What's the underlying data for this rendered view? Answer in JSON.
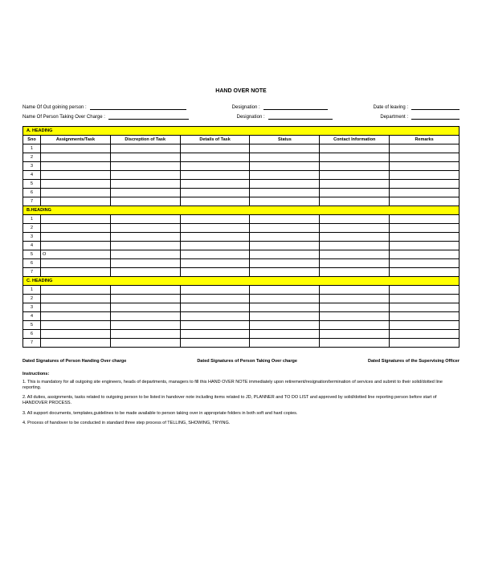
{
  "title": "HAND OVER NOTE",
  "header": {
    "row1": {
      "outgoing_label": "Name Of Out goining person :",
      "designation_label": "Designation :",
      "date_label": "Date of leaving :"
    },
    "row2": {
      "taking_over_label": "Name Of Person Taking Over Charge :",
      "designation_label": "Designation :",
      "department_label": "Department :"
    }
  },
  "columns": [
    "Sno",
    "Assignments/Task",
    "Discreption of Task",
    "Details of Task",
    "Status",
    "Contact Information",
    "Remarks"
  ],
  "sections": [
    {
      "title": "A. HEADING",
      "rows": [
        "1",
        "2",
        "3",
        "4",
        "5",
        "6",
        "7"
      ],
      "special": {}
    },
    {
      "title": "B.HEADING",
      "rows": [
        "1",
        "2",
        "3",
        "4",
        "5",
        "6",
        "7"
      ],
      "special": {
        "4": "O"
      }
    },
    {
      "title": "C. HEADING",
      "rows": [
        "1",
        "2",
        "3",
        "4",
        "5",
        "6",
        "7"
      ],
      "special": {}
    }
  ],
  "signatures": {
    "left": "Dated Signatures of Person Handing Over charge",
    "mid": "Dated Signatures of Person Taking Over charge",
    "right": "Dated Signatures of the Supervising Officer"
  },
  "instructions": {
    "heading": "Instructions:",
    "items": [
      "1. This is mandatory for all outgoing site engineers, heads of departments, managers to fill this HAND OVER NOTE immediately upon retirement/resignation/termination of services and submit to their solid/dotted line reporting.",
      "2. All duties, assignments, tasks related to outgoing person to be listed in handover note including items related to JD, PLANNER and TO DO LIST and approved by solid/dotted line reporting person before start of HANDOVER PROCESS.",
      "3. All support documents, templates,guidelines to be made available to person taking over in appropriate folders in both soft and hard copies.",
      "4. Process of handover to be conducted in standard three step process of TELLING, SHOWING, TRYING."
    ]
  }
}
